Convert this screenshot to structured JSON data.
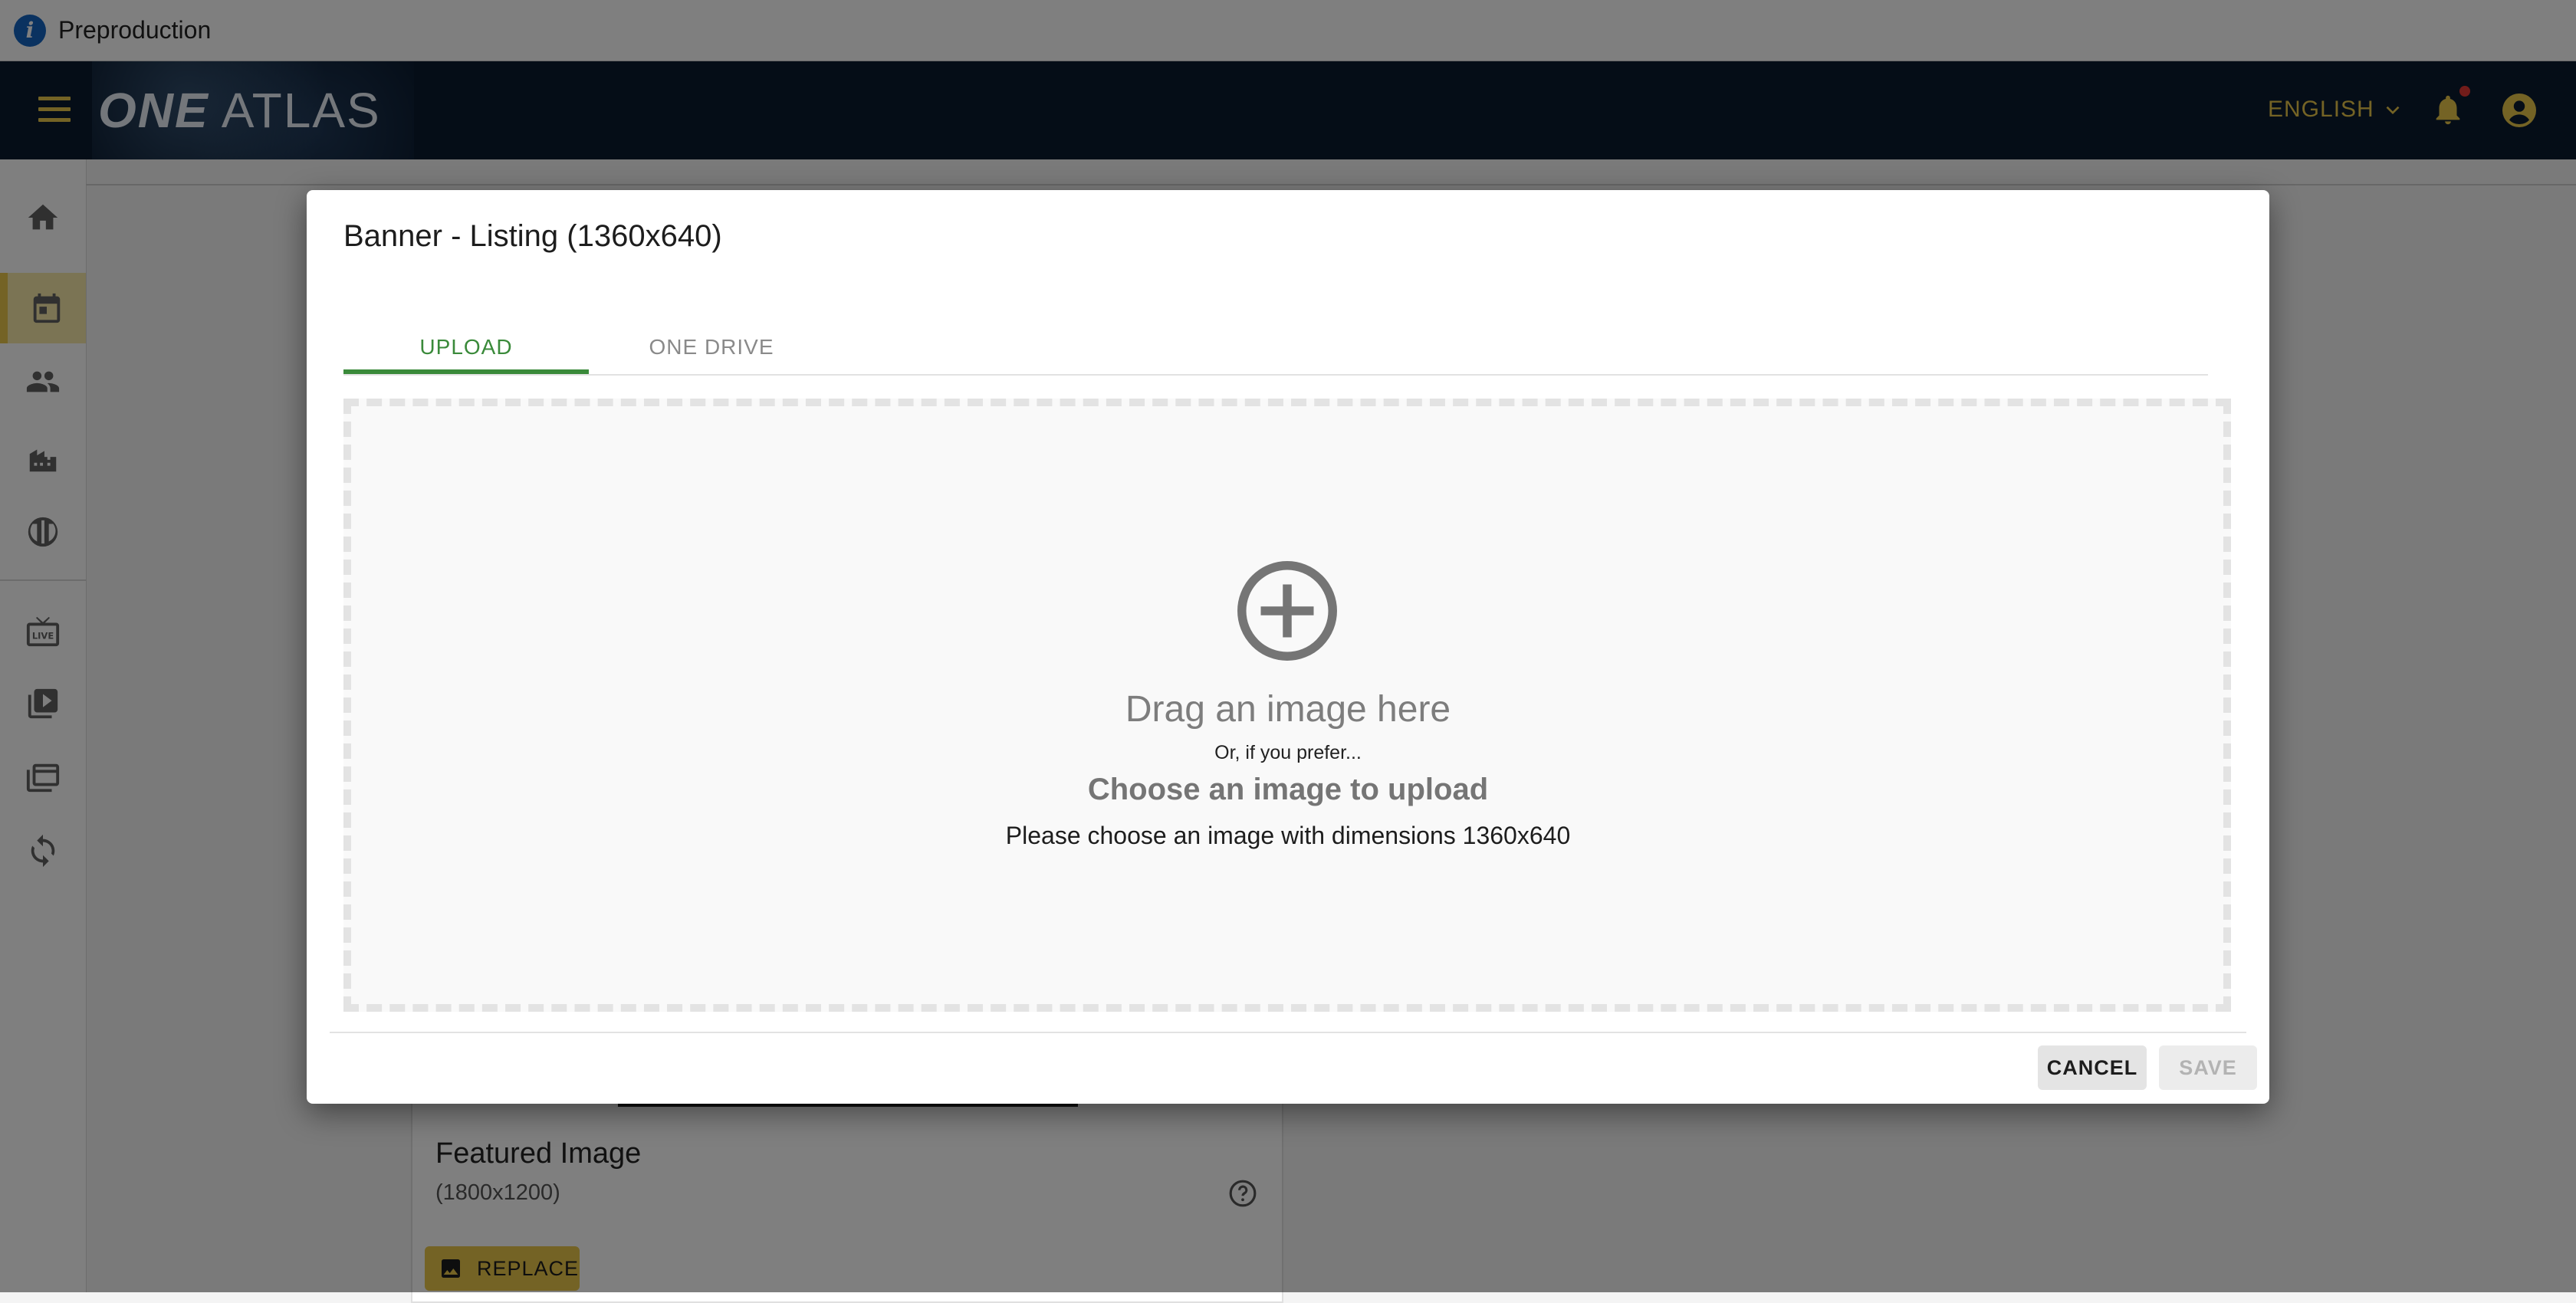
{
  "environment_bar": {
    "label": "Preproduction",
    "icon": "info-icon",
    "icon_glyph": "i"
  },
  "header": {
    "logo_part1": "ONE",
    "logo_part2": "ATLAS",
    "language": "ENGLISH",
    "notification_indicator_color": "#e53935",
    "accent_color": "#e8c64a",
    "background_color": "#0a1a2e"
  },
  "sidebar": {
    "items": [
      {
        "icon": "home-icon",
        "active": false
      },
      {
        "icon": "calendar-icon",
        "active": true
      },
      {
        "icon": "people-icon",
        "active": false
      },
      {
        "icon": "buildings-icon",
        "active": false
      },
      {
        "icon": "shield-icon",
        "active": false
      },
      {
        "icon": "live-tv-icon",
        "active": false
      },
      {
        "icon": "video-library-icon",
        "active": false
      },
      {
        "icon": "image-library-icon",
        "active": false
      },
      {
        "icon": "sync-icon",
        "active": false
      }
    ]
  },
  "background_card": {
    "title": "Featured Image",
    "subtitle": "(1800x1200)",
    "replace_label": "REPLACE"
  },
  "dialog": {
    "title": "Banner - Listing (1360x640)",
    "tabs": [
      {
        "label": "UPLOAD",
        "active": true
      },
      {
        "label": "ONE DRIVE",
        "active": false
      }
    ],
    "dropzone": {
      "drag_text": "Drag an image here",
      "or_text": "Or, if you prefer...",
      "choose_text": "Choose an image to upload",
      "dimensions_text": "Please choose an image with dimensions 1360x640"
    },
    "actions": {
      "cancel_label": "CANCEL",
      "save_label": "SAVE",
      "save_enabled": false
    },
    "active_tab_color": "#3a8a3a"
  }
}
